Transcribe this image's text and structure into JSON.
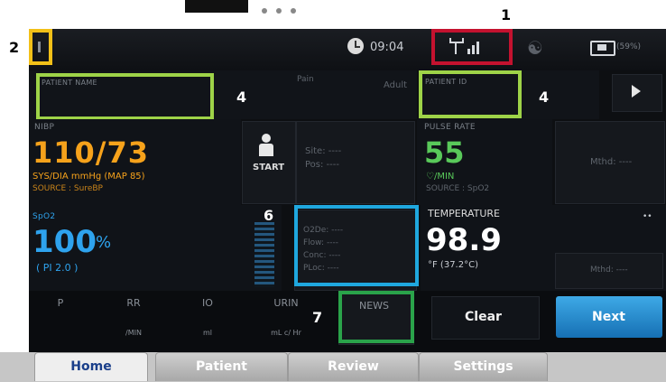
{
  "callouts": {
    "c1": "1",
    "c2": "2",
    "c4a": "4",
    "c4b": "4",
    "c6": "6",
    "c7": "7"
  },
  "status_bar": {
    "time": "09:04",
    "battery_percent": "(59%)"
  },
  "patient": {
    "name_label": "PATIENT NAME",
    "type_label": "Adult",
    "type_sub": "Pain",
    "id_label": "PATIENT ID"
  },
  "nibp": {
    "label": "NIBP",
    "value": "110/73",
    "unit": "SYS/DIA mmHg (MAP 85)",
    "source": "SOURCE : SureBP",
    "start_label": "START",
    "site_label": "Site: ----",
    "pos_label": "Pos: ----"
  },
  "pulse": {
    "label": "PULSE RATE",
    "value": "55",
    "unit": "♡/MIN",
    "source": "SOURCE : SpO2",
    "mthd": "Mthd: ----"
  },
  "spo2": {
    "label": "SpO2",
    "value": "100",
    "unit": "%",
    "pi": "( PI 2.0 )",
    "o2dev": "O2De: ----",
    "flow": "Flow: ----",
    "conc": "Conc: ----",
    "ploc": "PLoc: ----"
  },
  "temperature": {
    "label": "TEMPERATURE",
    "value": "98.9",
    "unit": "°F (37.2°C)",
    "mthd": "Mthd: ----"
  },
  "params": {
    "p": "P",
    "rr": "RR",
    "rr_sub": "/MIN",
    "io": "IO",
    "io_sub": "ml",
    "urine": "URIN",
    "urine_sub": "mL c/ Hr",
    "news": "NEWS"
  },
  "buttons": {
    "clear": "Clear",
    "next": "Next"
  },
  "tabs": {
    "home": "Home",
    "patient": "Patient",
    "review": "Review",
    "settings": "Settings"
  },
  "colors": {
    "nibp_orange": "#f6a21b",
    "pulse_green": "#59c95a",
    "spo2_blue": "#2ea3ee",
    "callout_red": "#c4122f",
    "callout_yellow": "#f2c018",
    "callout_lime": "#9ed348",
    "callout_cyan": "#1fa7de",
    "callout_green": "#2aa34a",
    "next_blue": "#1f8fd1"
  }
}
